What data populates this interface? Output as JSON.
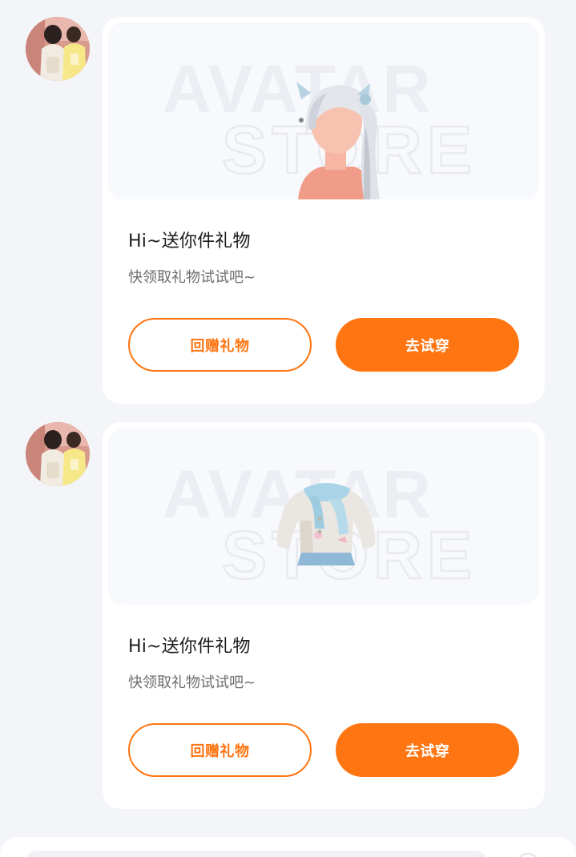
{
  "messages": [
    {
      "avatar_icon": "user-avatar-photo",
      "watermark": {
        "line1": "AVATAR",
        "line2": "STORE"
      },
      "item_icon": "hair-twintails-icon",
      "title": "Hi~送你件礼物",
      "subtitle": "快领取礼物试试吧~",
      "return_gift_label": "回赠礼物",
      "try_on_label": "去试穿"
    },
    {
      "avatar_icon": "user-avatar-photo",
      "watermark": {
        "line1": "AVATAR",
        "line2": "STORE"
      },
      "item_icon": "jacket-scarf-icon",
      "title": "Hi~送你件礼物",
      "subtitle": "快领取礼物试试吧~",
      "return_gift_label": "回赠礼物",
      "try_on_label": "去试穿"
    }
  ],
  "colors": {
    "accent": "#ff7512",
    "background": "#f4f5f9",
    "card": "#ffffff",
    "preview_bg": "#f8f9fc",
    "title_text": "#1b1b1f",
    "subtitle_text": "#6d6d72"
  }
}
